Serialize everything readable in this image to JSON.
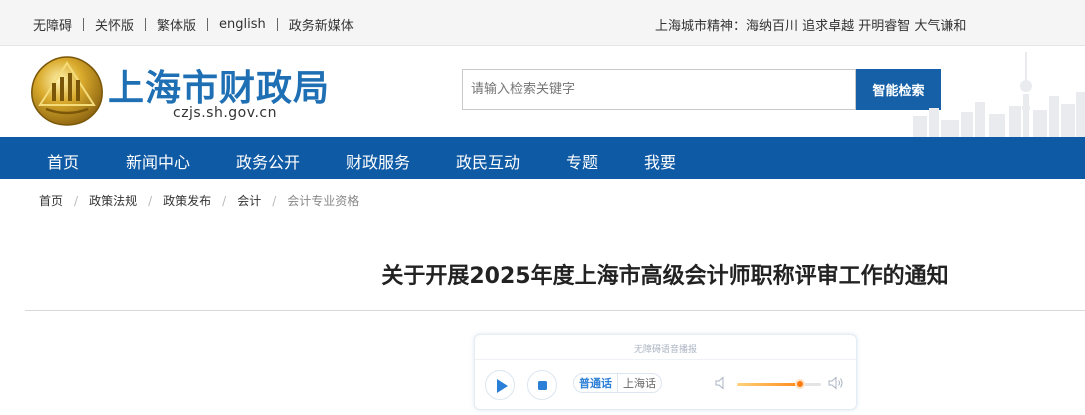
{
  "topbar": {
    "links": [
      "无障碍",
      "关怀版",
      "繁体版",
      "english",
      "政务新媒体"
    ],
    "motto": "上海城市精神：海纳百川 追求卓越 开明睿智 大气谦和"
  },
  "header": {
    "site_name": "上海市财政局",
    "domain": "czjs.sh.gov.cn",
    "search_placeholder": "请输入检索关键字",
    "search_button": "智能检索"
  },
  "nav": [
    "首页",
    "新闻中心",
    "政务公开",
    "财政服务",
    "政民互动",
    "专题",
    "我要"
  ],
  "breadcrumb": [
    "首页",
    "政策法规",
    "政策发布",
    "会计",
    "会计专业资格"
  ],
  "article": {
    "title": "关于开展2025年度上海市高级会计师职称评审工作的通知"
  },
  "player": {
    "title": "无障碍语音播报",
    "lang_on": "普通话",
    "lang_off": "上海话",
    "volume": 0.75
  },
  "colors": {
    "nav_bg": "#0f5aa5",
    "brand_blue": "#1e6fb3",
    "search_button_bg": "#1560a6",
    "volume_accent": "#ff7a10"
  }
}
